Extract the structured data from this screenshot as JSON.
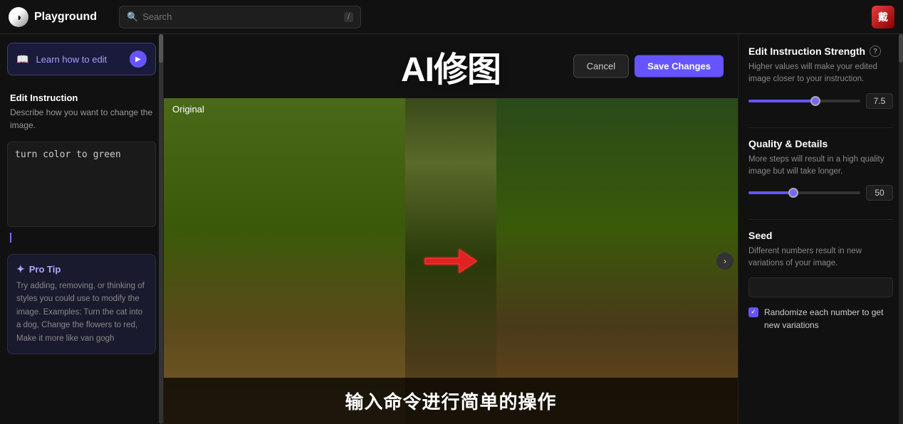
{
  "nav": {
    "logo_text": "Playground",
    "search_placeholder": "Search",
    "search_slash": "/"
  },
  "left_sidebar": {
    "learn_btn_label": "Learn how to edit",
    "learn_btn_icon": "📖",
    "edit_instruction_title": "Edit Instruction",
    "edit_instruction_desc": "Describe how you want to change the image.",
    "edit_textarea_value": "turn color to green",
    "pro_tip_title": "Pro Tip",
    "pro_tip_icon": "✦",
    "pro_tip_text": "Try adding, removing, or thinking of styles you could use to modify the image. Examples: Turn the cat into a dog, Change the flowers to red, Make it more like van gogh"
  },
  "center": {
    "title": "AI修图",
    "cancel_label": "Cancel",
    "save_label": "Save Changes",
    "original_label": "Original",
    "subtitle": "输入命令进行简单的操作"
  },
  "right_sidebar": {
    "edit_strength_title": "Edit Instruction Strength",
    "edit_strength_desc": "Higher values will make your edited image closer to your instruction.",
    "edit_strength_value": "7.5",
    "edit_strength_pct": 60,
    "quality_title": "Quality & Details",
    "quality_desc": "More steps will result in a high quality image but will take longer.",
    "quality_value": "50",
    "quality_pct": 40,
    "seed_title": "Seed",
    "seed_desc": "Different numbers result in new variations of your image.",
    "seed_placeholder": "",
    "randomize_label": "Randomize each number to get new variations"
  },
  "icons": {
    "logo": "◑",
    "search": "🔍",
    "play": "▶",
    "chevron_right": "›",
    "info": "?"
  }
}
